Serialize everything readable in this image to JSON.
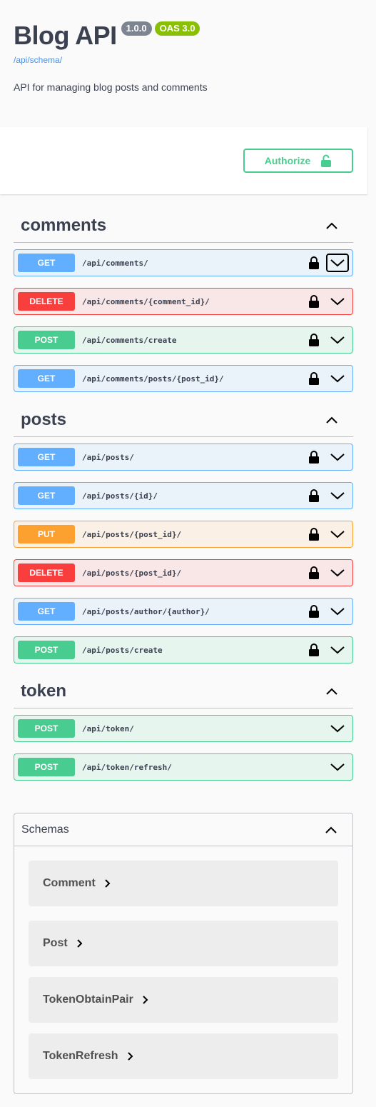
{
  "info": {
    "title": "Blog API",
    "version": "1.0.0",
    "oas": "OAS 3.0",
    "schema_url": "/api/schema/",
    "description": "API for managing blog posts and comments"
  },
  "auth": {
    "label": "Authorize",
    "icon": "unlock-icon"
  },
  "colors": {
    "get": "#61affe",
    "post": "#49cc90",
    "delete": "#f93e3e",
    "put": "#fca130"
  },
  "tags": [
    {
      "name": "comments",
      "ops": [
        {
          "method": "GET",
          "path": "/api/comments/",
          "locked": true
        },
        {
          "method": "DELETE",
          "path": "/api/comments/{comment_id}/",
          "locked": true
        },
        {
          "method": "POST",
          "path": "/api/comments/create",
          "locked": true
        },
        {
          "method": "GET",
          "path": "/api/comments/posts/{post_id}/",
          "locked": true
        }
      ]
    },
    {
      "name": "posts",
      "ops": [
        {
          "method": "GET",
          "path": "/api/posts/",
          "locked": true
        },
        {
          "method": "GET",
          "path": "/api/posts/{id}/",
          "locked": true
        },
        {
          "method": "PUT",
          "path": "/api/posts/{post_id}/",
          "locked": true
        },
        {
          "method": "DELETE",
          "path": "/api/posts/{post_id}/",
          "locked": true
        },
        {
          "method": "GET",
          "path": "/api/posts/author/{author}/",
          "locked": true
        },
        {
          "method": "POST",
          "path": "/api/posts/create",
          "locked": true
        }
      ]
    },
    {
      "name": "token",
      "ops": [
        {
          "method": "POST",
          "path": "/api/token/",
          "locked": false
        },
        {
          "method": "POST",
          "path": "/api/token/refresh/",
          "locked": false
        }
      ]
    }
  ],
  "schemas": {
    "title": "Schemas",
    "items": [
      "Comment",
      "Post",
      "TokenObtainPair",
      "TokenRefresh"
    ]
  }
}
